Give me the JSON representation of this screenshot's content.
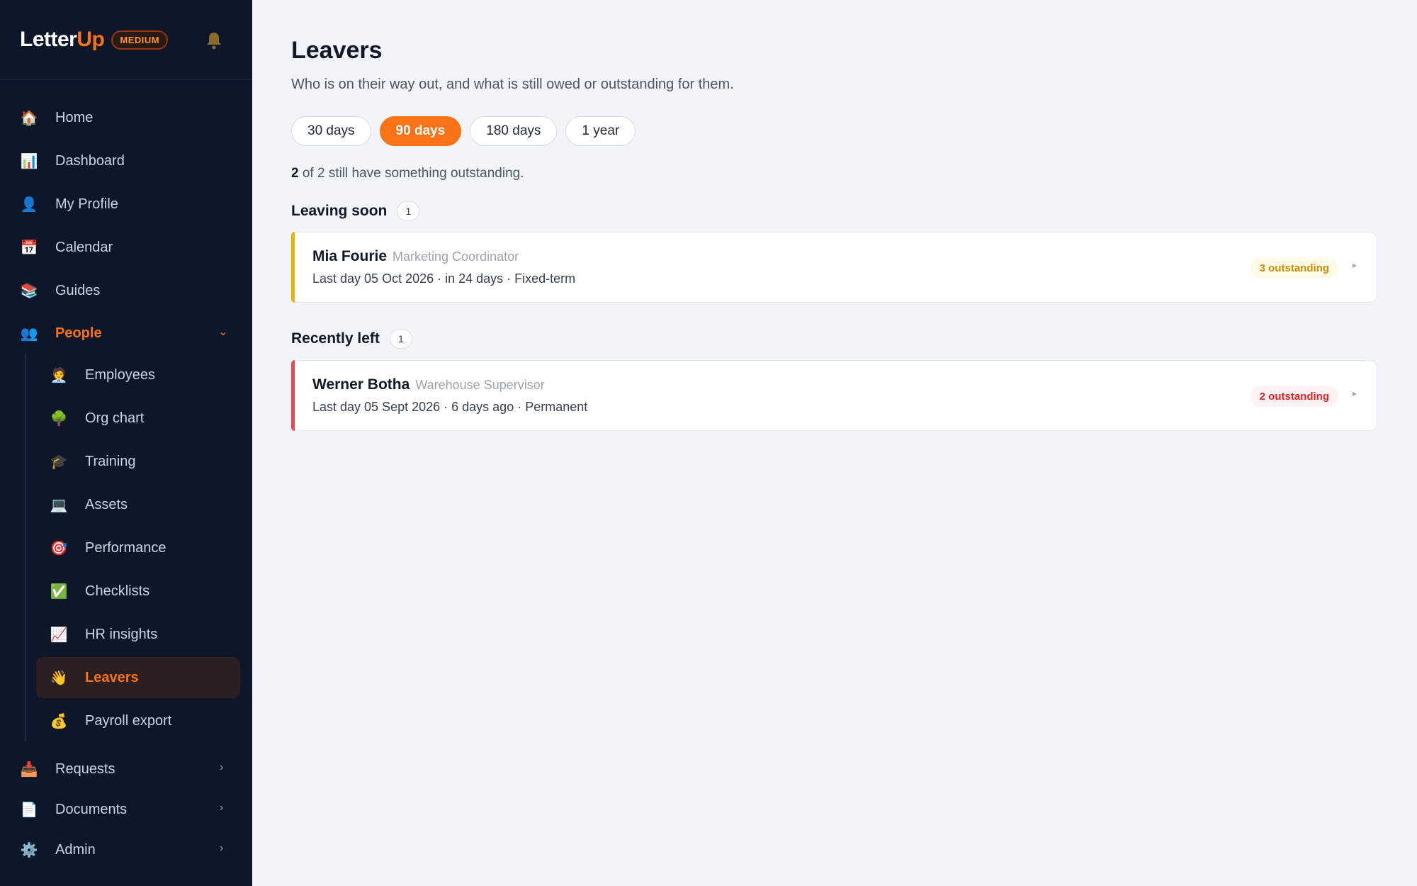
{
  "app": {
    "logo_main": "Letter",
    "logo_accent": "Up",
    "tier": "MEDIUM"
  },
  "sidebar": {
    "items": [
      {
        "label": "Home",
        "icon": "🏠"
      },
      {
        "label": "Dashboard",
        "icon": "📊"
      },
      {
        "label": "My Profile",
        "icon": "👤"
      },
      {
        "label": "Calendar",
        "icon": "📅"
      },
      {
        "label": "Guides",
        "icon": "📚"
      },
      {
        "label": "People",
        "icon": "👥"
      }
    ],
    "people_sub": [
      {
        "label": "Employees",
        "icon": "🧑‍💼"
      },
      {
        "label": "Org chart",
        "icon": "🌳"
      },
      {
        "label": "Training",
        "icon": "🎓"
      },
      {
        "label": "Assets",
        "icon": "💻"
      },
      {
        "label": "Performance",
        "icon": "🎯"
      },
      {
        "label": "Checklists",
        "icon": "✅"
      },
      {
        "label": "HR insights",
        "icon": "📈"
      },
      {
        "label": "Leavers",
        "icon": "👋"
      },
      {
        "label": "Payroll export",
        "icon": "💰"
      }
    ],
    "bottom": [
      {
        "label": "Requests",
        "icon": "📥"
      },
      {
        "label": "Documents",
        "icon": "📄"
      },
      {
        "label": "Admin",
        "icon": "⚙️"
      }
    ]
  },
  "page": {
    "title": "Leavers",
    "subtitle": "Who is on their way out, and what is still owed or outstanding for them.",
    "filters": [
      "30 days",
      "90 days",
      "180 days",
      "1 year"
    ],
    "summary_count": "2",
    "summary_rest": " of 2 still have something outstanding."
  },
  "sections": {
    "leaving_soon": {
      "title": "Leaving soon",
      "count": "1"
    },
    "recently_left": {
      "title": "Recently left",
      "count": "1"
    }
  },
  "leavers": {
    "mia": {
      "name": "Mia Fourie",
      "role": "Marketing Coordinator",
      "meta": "Last day 05 Oct 2026 · in 24 days · Fixed-term",
      "badge": "3 outstanding"
    },
    "werner": {
      "name": "Werner Botha",
      "role": "Warehouse Supervisor",
      "meta": "Last day 05 Sept 2026 · 6 days ago · Permanent",
      "badge": "2 outstanding"
    }
  },
  "colors": {
    "accent": "#f97316",
    "warning": "#eab308",
    "danger": "#ef4444",
    "sidebar_bg": "#0e1629"
  }
}
